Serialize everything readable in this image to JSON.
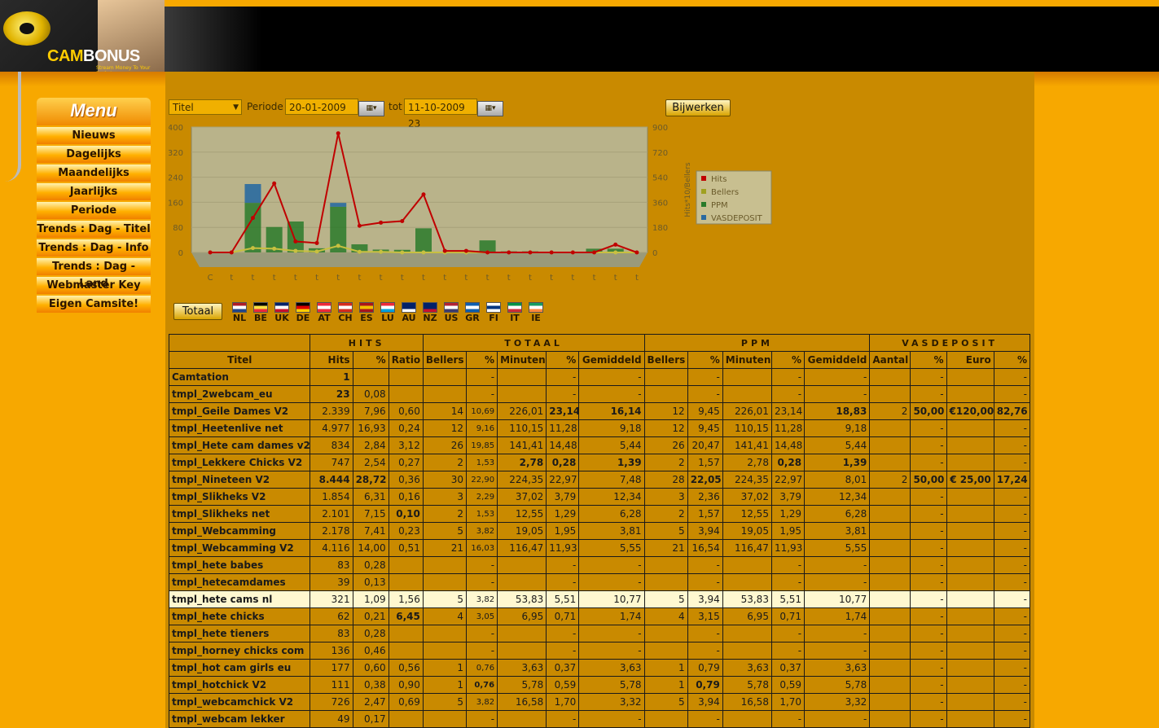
{
  "brand": {
    "name_a": "CAM",
    "name_b": "BONUS",
    "tagline": "Stream Money To Your Pocket"
  },
  "menu": {
    "title": "Menu",
    "items": [
      "Nieuws",
      "Dagelijks",
      "Maandelijks",
      "Jaarlijks",
      "Periode",
      "Trends : Dag - Titel",
      "Trends : Dag - Info",
      "Trends : Dag - Land",
      "Webmaster Key",
      "Eigen Camsite!"
    ]
  },
  "toolbar": {
    "select_value": "Titel",
    "period_label": "Periode",
    "from_date": "20-01-2009",
    "to_label": "tot",
    "to_date": "11-10-2009 23",
    "update_button": "Bijwerken"
  },
  "chart_data": {
    "type": "bar",
    "categories": [
      "C",
      "t",
      "t",
      "t",
      "t",
      "t",
      "t",
      "t",
      "t",
      "t",
      "t",
      "t",
      "t",
      "t",
      "t",
      "t",
      "t",
      "t",
      "t",
      "t",
      "t"
    ],
    "left_axis": {
      "label": "",
      "ticks": [
        400,
        320,
        240,
        160,
        80,
        0
      ],
      "ylim": [
        0,
        400
      ]
    },
    "right_axis": {
      "label": "Hits*10/Bellers",
      "ticks": [
        900,
        720,
        540,
        360,
        180,
        0
      ],
      "ylim": [
        0,
        900
      ]
    },
    "legend": [
      "Hits",
      "Bellers",
      "PPM",
      "VASDEPOSIT"
    ],
    "legend_colors": [
      "#c00000",
      "#a0a020",
      "#2a7a2a",
      "#2a6aa0"
    ],
    "series": [
      {
        "name": "Hits",
        "values": [
          0,
          0,
          110,
          220,
          35,
          30,
          380,
          85,
          95,
          100,
          185,
          5,
          5,
          0,
          0,
          0,
          0,
          0,
          0,
          25,
          0
        ]
      },
      {
        "name": "Bellers",
        "values": [
          0,
          0,
          14,
          12,
          5,
          3,
          21,
          2,
          2,
          0,
          0,
          0,
          0,
          0,
          0,
          0,
          0,
          0,
          0,
          0,
          0
        ]
      },
      {
        "name": "PPM",
        "values": [
          0,
          0,
          226,
          116,
          141,
          19,
          208,
          37,
          13,
          12,
          110,
          0,
          0,
          55,
          5,
          5,
          0,
          0,
          17,
          17,
          0
        ]
      },
      {
        "name": "VASDEPOSIT",
        "values": [
          0,
          0,
          120,
          0,
          0,
          0,
          25,
          0,
          0,
          0,
          0,
          0,
          0,
          0,
          0,
          0,
          0,
          0,
          0,
          0,
          0
        ]
      }
    ]
  },
  "totals_button": "Totaal",
  "flags": [
    {
      "code": "NL",
      "colors": [
        "#ae1c28",
        "#ffffff",
        "#21468b"
      ]
    },
    {
      "code": "BE",
      "colors": [
        "#000000",
        "#fae042",
        "#ed2939"
      ]
    },
    {
      "code": "UK",
      "colors": [
        "#012169",
        "#ffffff",
        "#c8102e"
      ]
    },
    {
      "code": "DE",
      "colors": [
        "#000000",
        "#dd0000",
        "#ffce00"
      ]
    },
    {
      "code": "AT",
      "colors": [
        "#ed2939",
        "#ffffff",
        "#ed2939"
      ]
    },
    {
      "code": "CH",
      "colors": [
        "#d52b1e",
        "#ffffff",
        "#d52b1e"
      ]
    },
    {
      "code": "ES",
      "colors": [
        "#aa151b",
        "#f1bf00",
        "#aa151b"
      ]
    },
    {
      "code": "LU",
      "colors": [
        "#ed2939",
        "#ffffff",
        "#00a1de"
      ]
    },
    {
      "code": "AU",
      "colors": [
        "#012169",
        "#012169",
        "#ffffff"
      ]
    },
    {
      "code": "NZ",
      "colors": [
        "#012169",
        "#012169",
        "#c8102e"
      ]
    },
    {
      "code": "US",
      "colors": [
        "#b22234",
        "#ffffff",
        "#3c3b6e"
      ]
    },
    {
      "code": "GR",
      "colors": [
        "#0d5eaf",
        "#ffffff",
        "#0d5eaf"
      ]
    },
    {
      "code": "FI",
      "colors": [
        "#ffffff",
        "#003580",
        "#ffffff"
      ]
    },
    {
      "code": "IT",
      "colors": [
        "#009246",
        "#ffffff",
        "#ce2b37"
      ]
    },
    {
      "code": "IE",
      "colors": [
        "#169b62",
        "#ffffff",
        "#ff883e"
      ]
    }
  ],
  "table": {
    "groups": [
      "HITS",
      "TOTAAL",
      "PPM",
      "VASDEPOSIT"
    ],
    "headers": [
      "Titel",
      "Hits",
      "%",
      "Ratio",
      "Bellers",
      "%",
      "Minuten",
      "%",
      "Gemiddeld",
      "Bellers",
      "%",
      "Minuten",
      "%",
      "Gemiddeld",
      "Aantal",
      "%",
      "Euro",
      "%"
    ],
    "rows": [
      [
        "Camtation",
        "1",
        "",
        "",
        "",
        "-",
        "",
        "-",
        "-",
        "",
        "-",
        "",
        "-",
        "-",
        "",
        "-",
        "",
        "-"
      ],
      [
        "tmpl_2webcam_eu",
        "23",
        "0,08",
        "",
        "",
        "-",
        "",
        "-",
        "-",
        "",
        "-",
        "",
        "-",
        "-",
        "",
        "-",
        "",
        "-"
      ],
      [
        "tmpl_Geile Dames V2",
        "2.339",
        "7,96",
        "0,60",
        "14",
        "10,69",
        "226,01",
        "23,14",
        "16,14",
        "12",
        "9,45",
        "226,01",
        "23,14",
        "18,83",
        "2",
        "50,00",
        "€120,00",
        "82,76"
      ],
      [
        "tmpl_Heetenlive net",
        "4.977",
        "16,93",
        "0,24",
        "12",
        "9,16",
        "110,15",
        "11,28",
        "9,18",
        "12",
        "9,45",
        "110,15",
        "11,28",
        "9,18",
        "",
        "-",
        "",
        "-"
      ],
      [
        "tmpl_Hete cam dames v2",
        "834",
        "2,84",
        "3,12",
        "26",
        "19,85",
        "141,41",
        "14,48",
        "5,44",
        "26",
        "20,47",
        "141,41",
        "14,48",
        "5,44",
        "",
        "-",
        "",
        "-"
      ],
      [
        "tmpl_Lekkere Chicks V2",
        "747",
        "2,54",
        "0,27",
        "2",
        "1,53",
        "2,78",
        "0,28",
        "1,39",
        "2",
        "1,57",
        "2,78",
        "0,28",
        "1,39",
        "",
        "-",
        "",
        "-"
      ],
      [
        "tmpl_Nineteen V2",
        "8.444",
        "28,72",
        "0,36",
        "30",
        "22,90",
        "224,35",
        "22,97",
        "7,48",
        "28",
        "22,05",
        "224,35",
        "22,97",
        "8,01",
        "2",
        "50,00",
        "€  25,00",
        "17,24"
      ],
      [
        "tmpl_Slikheks V2",
        "1.854",
        "6,31",
        "0,16",
        "3",
        "2,29",
        "37,02",
        "3,79",
        "12,34",
        "3",
        "2,36",
        "37,02",
        "3,79",
        "12,34",
        "",
        "-",
        "",
        "-"
      ],
      [
        "tmpl_Slikheks net",
        "2.101",
        "7,15",
        "0,10",
        "2",
        "1,53",
        "12,55",
        "1,29",
        "6,28",
        "2",
        "1,57",
        "12,55",
        "1,29",
        "6,28",
        "",
        "-",
        "",
        "-"
      ],
      [
        "tmpl_Webcamming",
        "2.178",
        "7,41",
        "0,23",
        "5",
        "3,82",
        "19,05",
        "1,95",
        "3,81",
        "5",
        "3,94",
        "19,05",
        "1,95",
        "3,81",
        "",
        "-",
        "",
        "-"
      ],
      [
        "tmpl_Webcamming V2",
        "4.116",
        "14,00",
        "0,51",
        "21",
        "16,03",
        "116,47",
        "11,93",
        "5,55",
        "21",
        "16,54",
        "116,47",
        "11,93",
        "5,55",
        "",
        "-",
        "",
        "-"
      ],
      [
        "tmpl_hete babes",
        "83",
        "0,28",
        "",
        "",
        "-",
        "",
        "-",
        "-",
        "",
        "-",
        "",
        "-",
        "-",
        "",
        "-",
        "",
        "-"
      ],
      [
        "tmpl_hetecamdames",
        "39",
        "0,13",
        "",
        "",
        "-",
        "",
        "-",
        "-",
        "",
        "-",
        "",
        "-",
        "-",
        "",
        "-",
        "",
        "-"
      ],
      [
        "tmpl_hete cams nl",
        "321",
        "1,09",
        "1,56",
        "5",
        "3,82",
        "53,83",
        "5,51",
        "10,77",
        "5",
        "3,94",
        "53,83",
        "5,51",
        "10,77",
        "",
        "-",
        "",
        "-"
      ],
      [
        "tmpl_hete chicks",
        "62",
        "0,21",
        "6,45",
        "4",
        "3,05",
        "6,95",
        "0,71",
        "1,74",
        "4",
        "3,15",
        "6,95",
        "0,71",
        "1,74",
        "",
        "-",
        "",
        "-"
      ],
      [
        "tmpl_hete tieners",
        "83",
        "0,28",
        "",
        "",
        "-",
        "",
        "-",
        "-",
        "",
        "-",
        "",
        "-",
        "-",
        "",
        "-",
        "",
        "-"
      ],
      [
        "tmpl_horney chicks com",
        "136",
        "0,46",
        "",
        "",
        "-",
        "",
        "-",
        "-",
        "",
        "-",
        "",
        "-",
        "-",
        "",
        "-",
        "",
        "-"
      ],
      [
        "tmpl_hot cam girls eu",
        "177",
        "0,60",
        "0,56",
        "1",
        "0,76",
        "3,63",
        "0,37",
        "3,63",
        "1",
        "0,79",
        "3,63",
        "0,37",
        "3,63",
        "",
        "-",
        "",
        "-"
      ],
      [
        "tmpl_hotchick V2",
        "111",
        "0,38",
        "0,90",
        "1",
        "0,76",
        "5,78",
        "0,59",
        "5,78",
        "1",
        "0,79",
        "5,78",
        "0,59",
        "5,78",
        "",
        "-",
        "",
        "-"
      ],
      [
        "tmpl_webcamchick V2",
        "726",
        "2,47",
        "0,69",
        "5",
        "3,82",
        "16,58",
        "1,70",
        "3,32",
        "5",
        "3,94",
        "16,58",
        "1,70",
        "3,32",
        "",
        "-",
        "",
        "-"
      ],
      [
        "tmpl_webcam lekker",
        "49",
        "0,17",
        "",
        "",
        "-",
        "",
        "-",
        "-",
        "",
        "-",
        "",
        "-",
        "-",
        "",
        "-",
        "",
        "-"
      ]
    ],
    "highlight_row": 13
  }
}
